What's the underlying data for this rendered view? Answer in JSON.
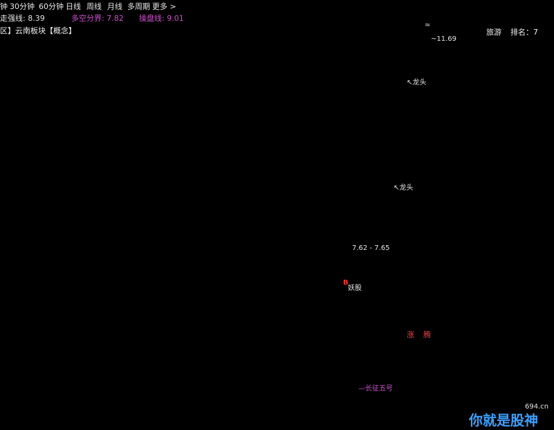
{
  "toolbar": {
    "tabs": [
      "钟",
      "30分钟",
      "60分钟",
      "日线",
      "周线",
      "月线",
      "多周期",
      "更多 >"
    ]
  },
  "indicators": {
    "trend_line": {
      "label": "走强线",
      "value": "8.39",
      "color": "#e6e6e6"
    },
    "bull_bear": {
      "label": "多空分界",
      "value": "7.82",
      "color": "#d050d0"
    },
    "control_line": {
      "label": "操盘线",
      "value": "9.01",
      "color": "#d050d0"
    }
  },
  "sector": {
    "text": "区】云南板块【概念】",
    "name": "旅游",
    "rank_label": "排名：7"
  },
  "annotations": {
    "high_price": "11.69",
    "dragon_head_1": "龙头",
    "dragon_head_2": "龙头",
    "range": "7.62 - 7.65",
    "demon_stock": "妖股",
    "b_marker": "B",
    "top_mark": "≈"
  },
  "lower_panel": {
    "zhang": "涨",
    "teng": "腾",
    "rocket_label": "长征五号"
  },
  "watermark": {
    "site": "694.cn",
    "slogan": "你就是股神"
  },
  "colors": {
    "bg": "#000000",
    "up_candle": "#e05050",
    "down_candle": "#40e0f0",
    "ma_white": "#ffffff",
    "ma_purple": "#a040c0",
    "ma_yellow": "#ffff60",
    "ma_gray": "#b0b0b0",
    "signal_yellow": "#ffe000",
    "blue_candle": "#3050ff"
  }
}
